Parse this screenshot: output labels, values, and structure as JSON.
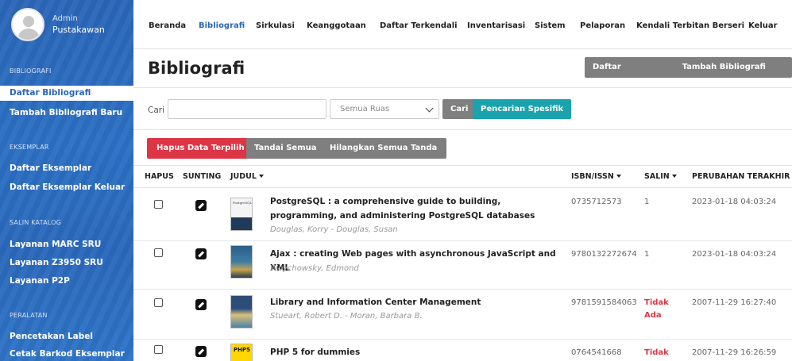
{
  "user": {
    "role": "Admin",
    "name": "Pustakawan"
  },
  "sidebar": {
    "sections": [
      {
        "title": "BIBLIOGRAFI",
        "items": [
          "Daftar Bibliografi",
          "Tambah Bibliografi Baru"
        ]
      },
      {
        "title": "EKSEMPLAR",
        "items": [
          "Daftar Eksemplar",
          "Daftar Eksemplar Keluar"
        ]
      },
      {
        "title": "SALIN KATALOG",
        "items": [
          "Layanan MARC SRU",
          "Layanan Z3950 SRU",
          "Layanan P2P"
        ]
      },
      {
        "title": "PERALATAN",
        "items": [
          "Pencetakan Label",
          "Cetak Barkod Eksemplar"
        ]
      }
    ]
  },
  "nav": [
    "Beranda",
    "Bibliografi",
    "Sirkulasi",
    "Keanggotaan",
    "Daftar Terkendali",
    "Inventarisasi",
    "Sistem",
    "Pelaporan",
    "Kendali Terbitan Berseri",
    "Keluar"
  ],
  "page": {
    "title": "Bibliografi",
    "list_button": "Daftar Bibliografi",
    "add_button": "Tambah Bibliografi Baru"
  },
  "search": {
    "label": "Cari",
    "value": "",
    "field_select": "Semua Ruas",
    "search_button": "Cari",
    "advanced_button": "Pencarian Spesifik"
  },
  "actions": {
    "delete_selected": "Hapus Data Terpilih",
    "mark_all": "Tandai Semua",
    "unmark_all": "Hilangkan Semua Tanda"
  },
  "table": {
    "headers": {
      "hapus": "HAPUS",
      "sunting": "SUNTING",
      "judul": "JUDUL",
      "isbn": "ISBN/ISSN",
      "salin": "SALIN",
      "updated": "PERUBAHAN TERAKHIR"
    },
    "rows": [
      {
        "title": "PostgreSQL : a comprehensive guide to building, programming, and administering PostgreSQL databases",
        "authors": "Douglas, Korry - Douglas, Susan",
        "isbn": "0735712573",
        "copies": "1",
        "updated": "2023-01-18 04:03:24",
        "cover_label": "PostgreSQL"
      },
      {
        "title": "Ajax : creating Web pages with asynchronous JavaScript and XML",
        "authors": "Woychowsky, Edmond",
        "isbn": "9780132272674",
        "copies": "1",
        "updated": "2023-01-18 04:03:24",
        "cover_label": ""
      },
      {
        "title": "Library and Information Center Management",
        "authors": "Stueart, Robert D. - Moran, Barbara B.",
        "isbn": "9781591584063",
        "copies": "Tidak Ada",
        "updated": "2007-11-29 16:27:40",
        "cover_label": ""
      },
      {
        "title": "PHP 5 for dummies",
        "authors": "",
        "isbn": "0764541668",
        "copies": "Tidak",
        "updated": "2007-11-29 16:26:59",
        "cover_label": "PHP5"
      }
    ]
  },
  "colors": {
    "primary": "#2a66b8",
    "danger": "#dc3545",
    "teal": "#1aa3ad",
    "gray": "#7f7f7f"
  }
}
